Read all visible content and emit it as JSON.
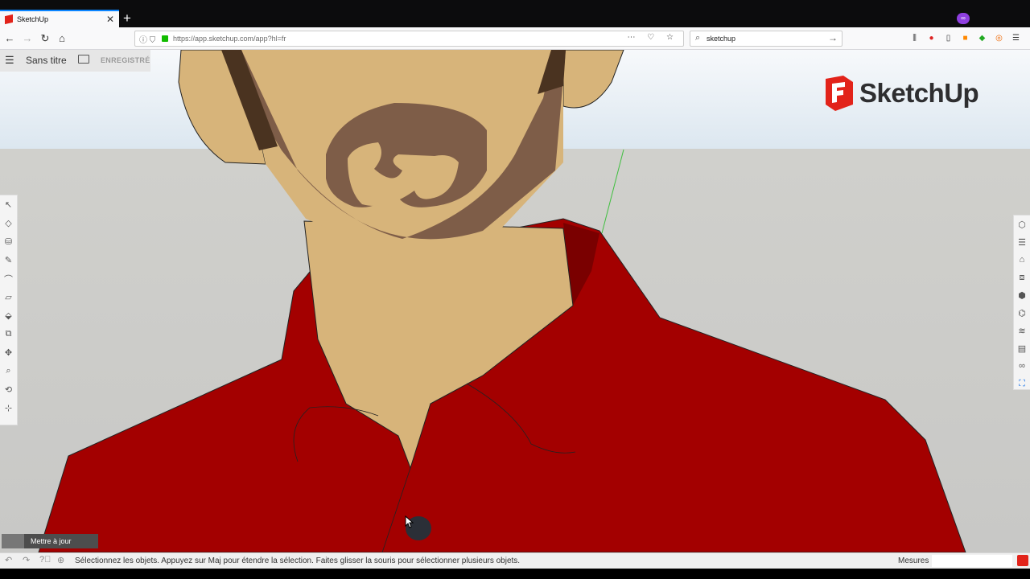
{
  "browser": {
    "tab_title": "SketchUp",
    "tab_close": "✕",
    "new_tab": "+",
    "url": "https://app.sketchup.com/app?hl=fr",
    "search_value": "sketchup",
    "private_icon": "∞"
  },
  "app": {
    "menu_icon": "☰",
    "file_title": "Sans titre",
    "save_status": "ENREGISTRÉ",
    "logo_text": "SketchUp",
    "update_label": "Mettre à jour"
  },
  "left_tools": [
    "select-icon",
    "eraser-icon",
    "paint-bucket-icon",
    "pencil-icon",
    "arc-icon",
    "rectangle-icon",
    "push-pull-icon",
    "offset-icon",
    "move-icon",
    "rotate-icon",
    "tape-measure-icon",
    "orbit-icon"
  ],
  "right_tools": [
    "entity-info-icon",
    "outliner-icon",
    "instructor-icon",
    "components-icon",
    "materials-icon",
    "styles-icon",
    "layers-icon",
    "scenes-icon",
    "display-icon",
    "3d-warehouse-icon"
  ],
  "status": {
    "message": "Sélectionnez les objets. Appuyez sur Maj pour étendre la sélection. Faites glisser la souris pour sélectionner plusieurs objets.",
    "measurements_label": "Mesures"
  },
  "colors": {
    "skin": "#d7b47a",
    "beard": "#7e5d48",
    "beard_dark": "#4a3320",
    "shirt": "#a30000",
    "shirt_shadow": "#7a0000",
    "brand_red": "#e2231a",
    "axis_green": "#3fbf3f"
  }
}
